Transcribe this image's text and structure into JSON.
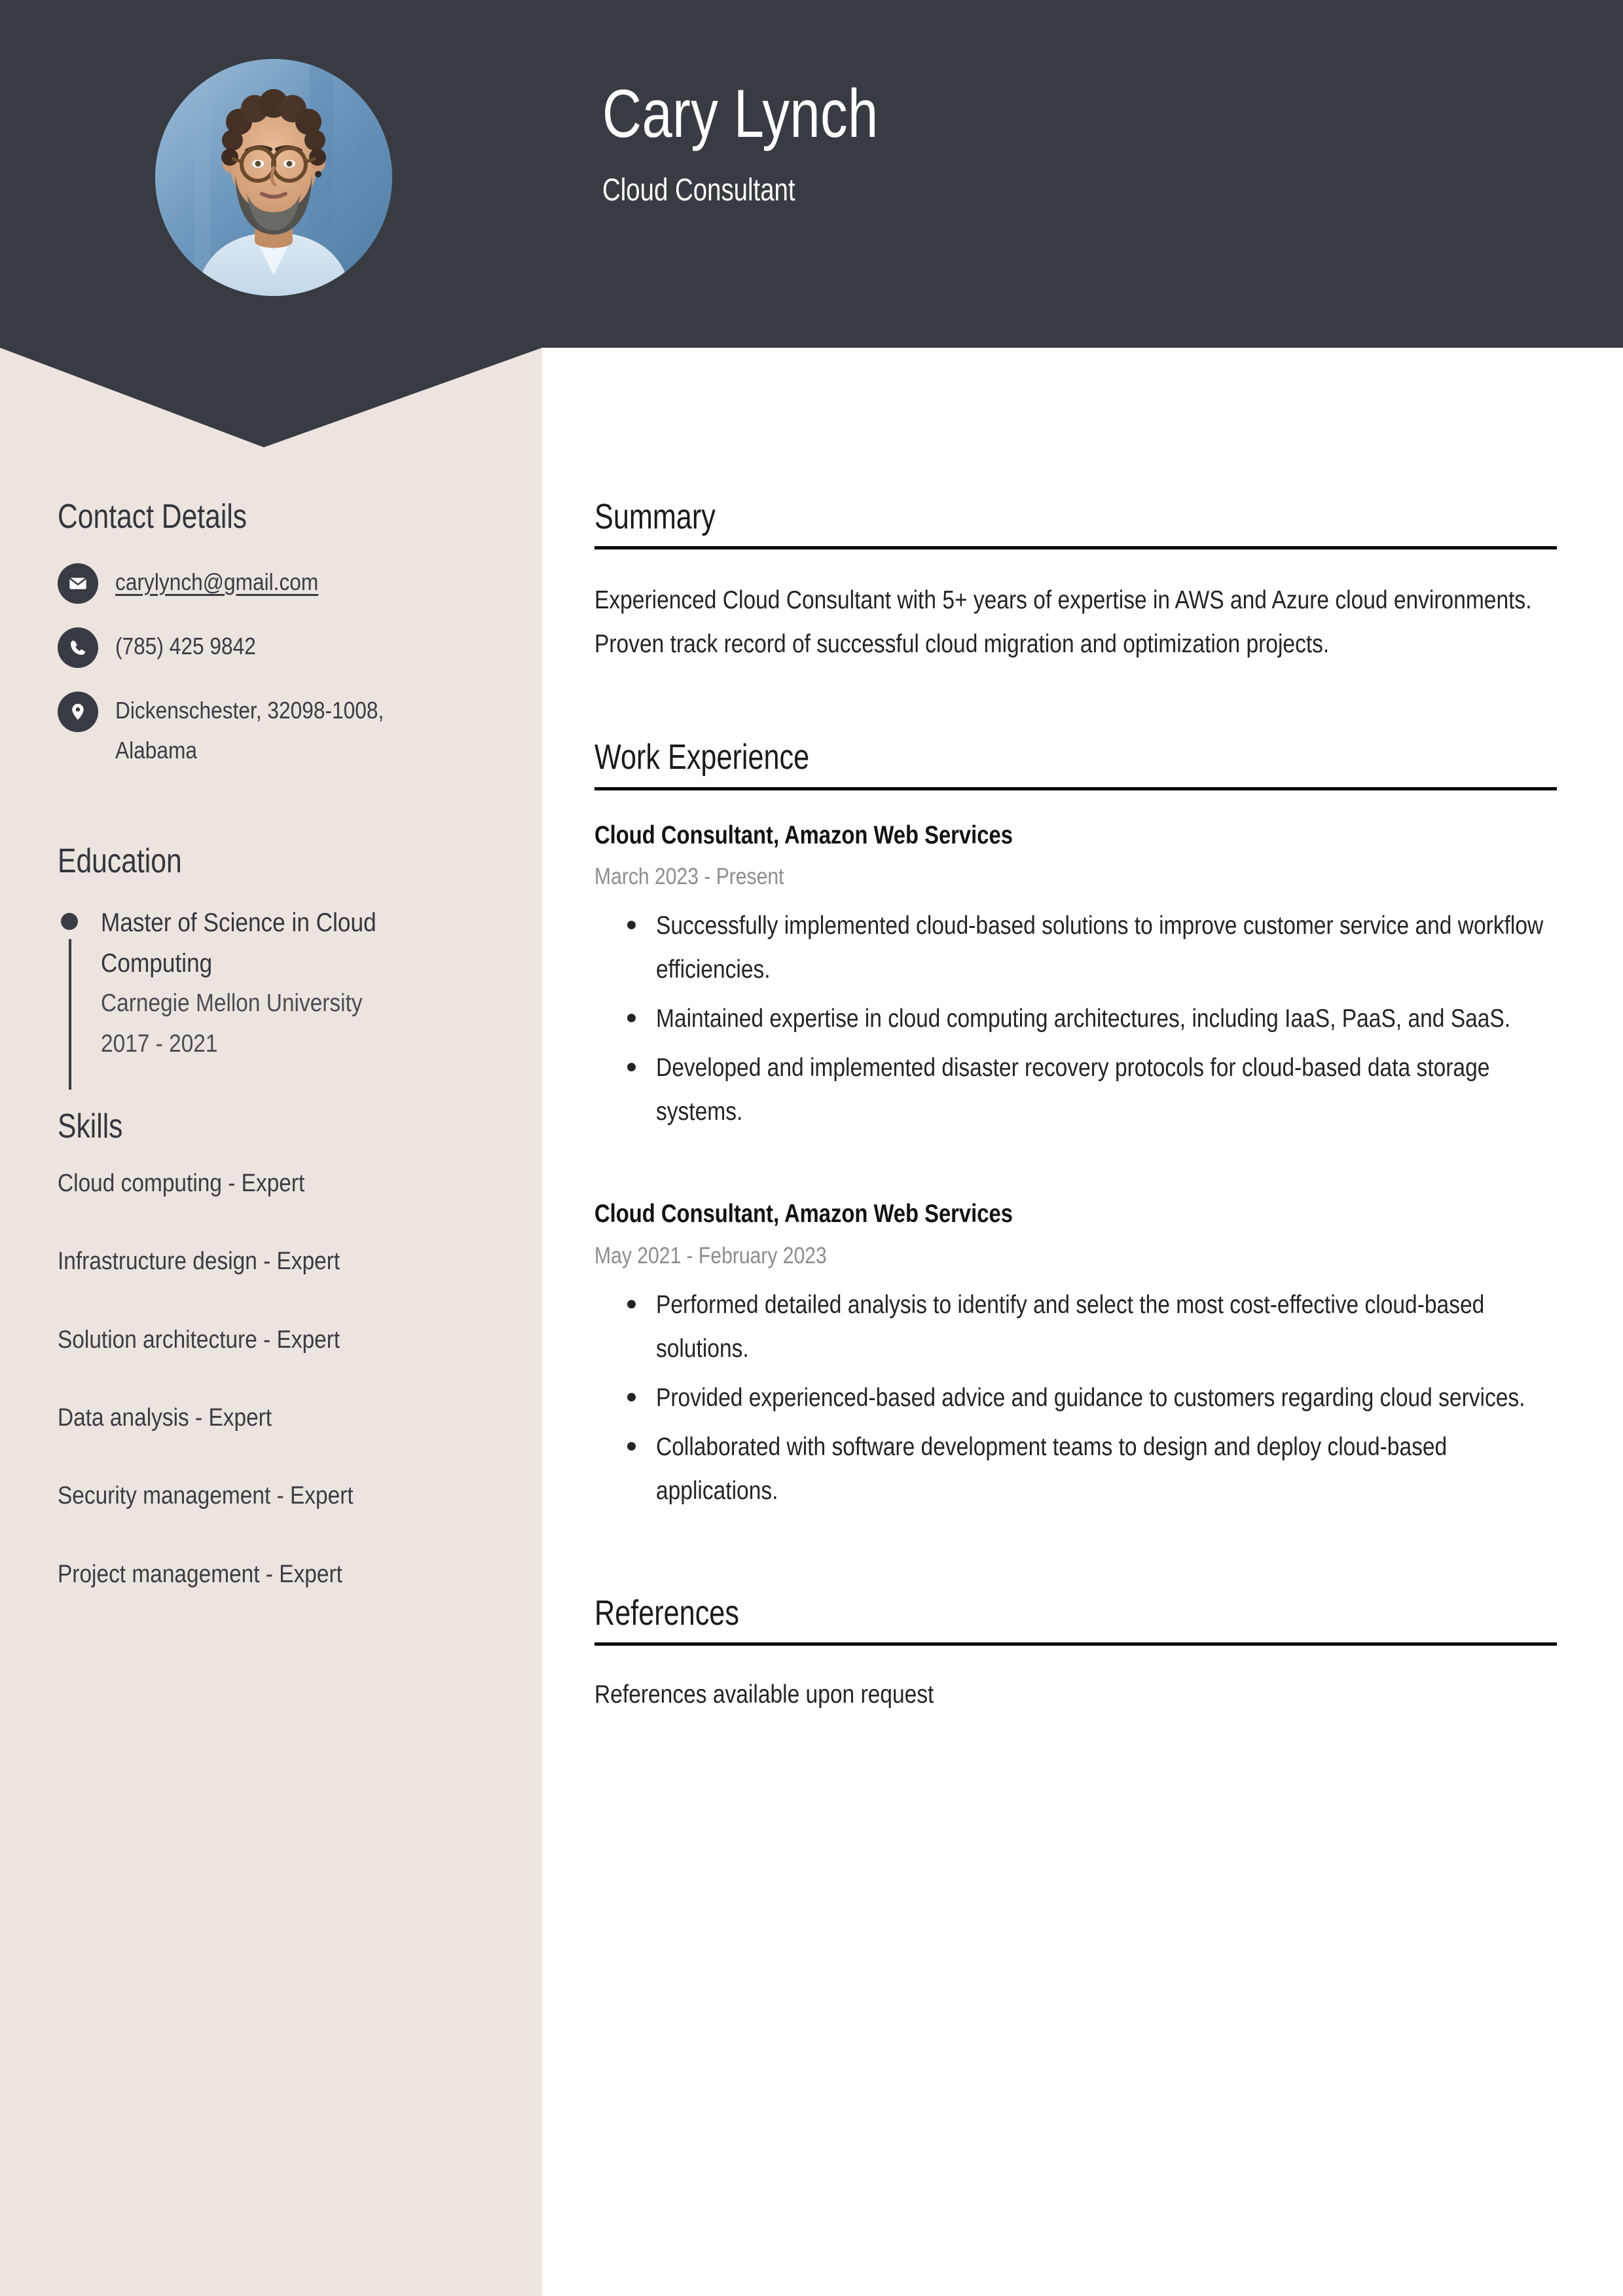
{
  "theme": {
    "header_bg": "#383B41",
    "sidebar_bg": "#ECE4DF",
    "main_bg": "#FFFFFF",
    "text_dark": "#33363C",
    "muted_text": "#8D8D8D",
    "rule_color": "#000000"
  },
  "header": {
    "name": "Cary Lynch",
    "title": "Cloud Consultant",
    "photo_alt": "profile-photo"
  },
  "sidebar": {
    "contact": {
      "heading": "Contact Details",
      "items": [
        {
          "icon": "envelope-icon",
          "value": "carylynch@gmail.com",
          "is_link": true
        },
        {
          "icon": "phone-icon",
          "value": "(785) 425 9842",
          "is_link": false
        },
        {
          "icon": "location-pin-icon",
          "value": "Dickenschester, 32098-1008, Alabama",
          "is_link": false
        }
      ]
    },
    "education": {
      "heading": "Education",
      "items": [
        {
          "degree": "Master of Science in Cloud Computing",
          "school": "Carnegie Mellon University",
          "dates": "2017 - 2021"
        }
      ]
    },
    "skills": {
      "heading": "Skills",
      "items": [
        "Cloud computing - Expert",
        "Infrastructure design - Expert",
        "Solution architecture - Expert",
        "Data analysis - Expert",
        "Security management - Expert",
        "Project management - Expert"
      ]
    }
  },
  "main": {
    "summary": {
      "heading": "Summary",
      "text": "Experienced Cloud Consultant with 5+ years of expertise in AWS and Azure cloud environments. Proven track record of successful cloud migration and optimization projects."
    },
    "work_experience": {
      "heading": "Work Experience",
      "jobs": [
        {
          "title": "Cloud Consultant, Amazon Web Services",
          "dates": "March 2023 - Present",
          "bullets": [
            "Successfully implemented cloud-based solutions to improve customer service and workflow efficiencies.",
            "Maintained expertise in cloud computing architectures, including IaaS, PaaS, and SaaS.",
            "Developed and implemented disaster recovery protocols for cloud-based data storage systems."
          ]
        },
        {
          "title": "Cloud Consultant, Amazon Web Services",
          "dates": "May 2021 - February 2023",
          "bullets": [
            "Performed detailed analysis to identify and select the most cost-effective cloud-based solutions.",
            "Provided experienced-based advice and guidance to customers regarding cloud services.",
            "Collaborated with software development teams to design and deploy cloud-based applications."
          ]
        }
      ]
    },
    "references": {
      "heading": "References",
      "text": "References available upon request"
    }
  }
}
